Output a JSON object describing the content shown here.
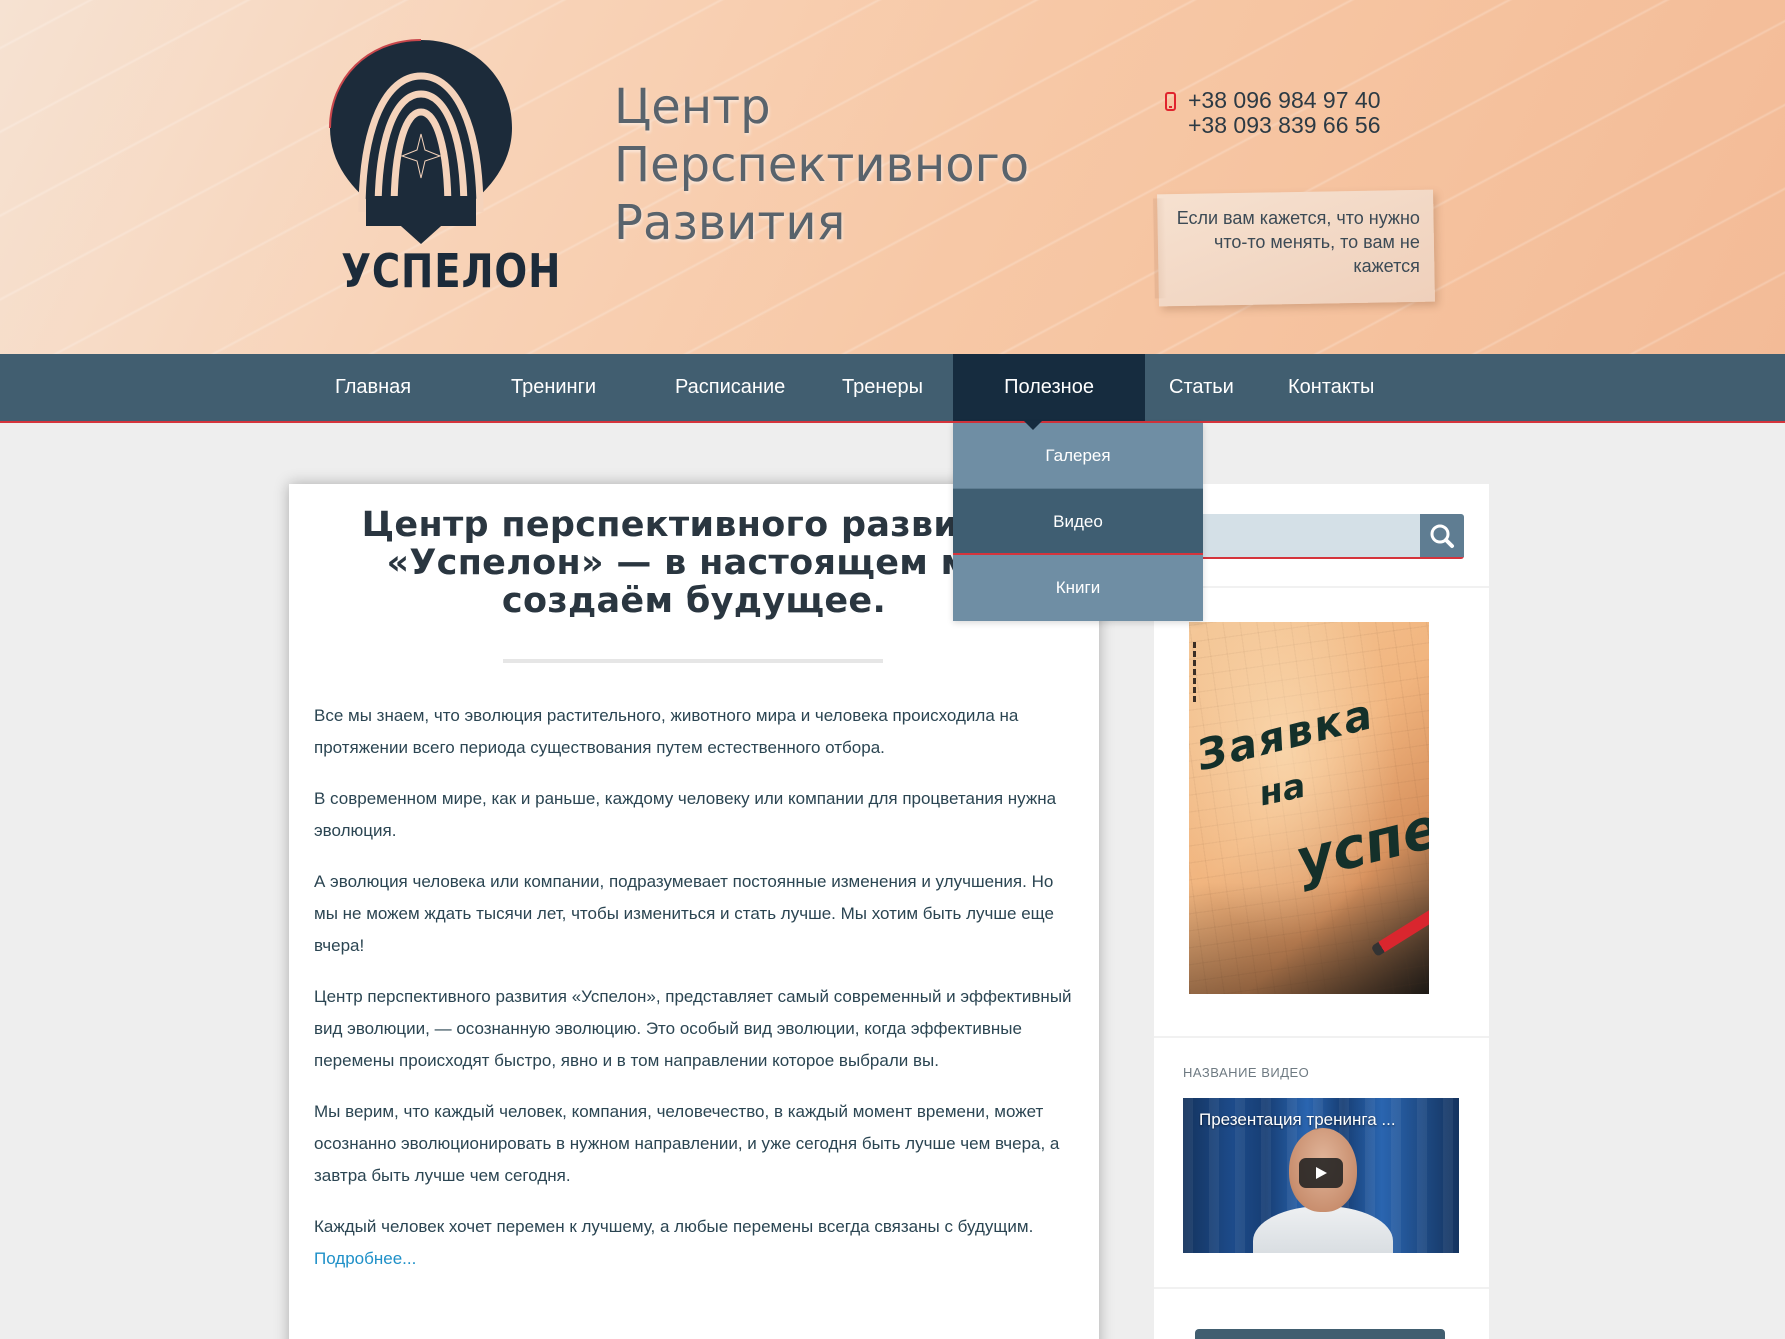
{
  "header": {
    "logo_text": "УСПЕЛОН",
    "title_lines": [
      "Центр",
      "Перспективного",
      "Развития"
    ],
    "phones": [
      "+38 096 984 97 40",
      "+38 093 839 66 56"
    ],
    "quote": "Если вам кажется, что нужно что-то менять, то вам не кажется"
  },
  "nav": {
    "items": [
      "Главная",
      "Тренинги",
      "Расписание",
      "Тренеры",
      "Полезное",
      "Статьи",
      "Контакты"
    ],
    "active": "Полезное",
    "dropdown": [
      "Галерея",
      "Видео",
      "Книги"
    ],
    "dropdown_active": "Видео"
  },
  "article": {
    "title": "Центр перспективного развития «Успелон» — в настоящем мы создаём будущее.",
    "paragraphs": [
      "Все мы знаем, что эволюция растительного, животного мира и человека происходила на протяжении всего периода существования путем естественного отбора.",
      "В современном мире, как и раньше, каждому человеку или компании для процветания нужна эволюция.",
      "А эволюция человека или компании, подразумевает постоянные изменения и улучшения. Но мы не можем ждать тысячи лет, чтобы измениться и стать лучше. Мы хотим быть лучше еще вчера!",
      "Центр перспективного развития «Успелон», представляет самый современный и эффективный вид эволюции, — осознанную эволюцию. Это особый вид эволюции, когда эффективные перемены происходят быстро, явно и в том направлении которое выбрали вы.",
      "Мы верим, что каждый человек, компания, человечество, в каждый момент времени, может осознанно эволюционировать в нужном направлении, и уже сегодня быть лучше чем вчера, а завтра быть лучше чем сегодня.",
      "Каждый человек хочет перемен к лучшему, а любые перемены всегда связаны с будущим."
    ],
    "more_link": "Подробнее..."
  },
  "sidebar": {
    "search_placeholder": "",
    "ad_lines": [
      "Заявка",
      "на",
      "успе"
    ],
    "video_label": "НАЗВАНИЕ ВИДЕО",
    "video_title": "Презентация тренинга ..."
  },
  "colors": {
    "nav_bg": "#415e70",
    "nav_active": "#162c3f",
    "accent_red": "#d5343c",
    "link": "#1e90c8",
    "dropdown_bg": "#6f8ea4"
  },
  "icons": [
    "phone-icon",
    "search-icon",
    "play-icon",
    "logo-emblem-icon"
  ]
}
